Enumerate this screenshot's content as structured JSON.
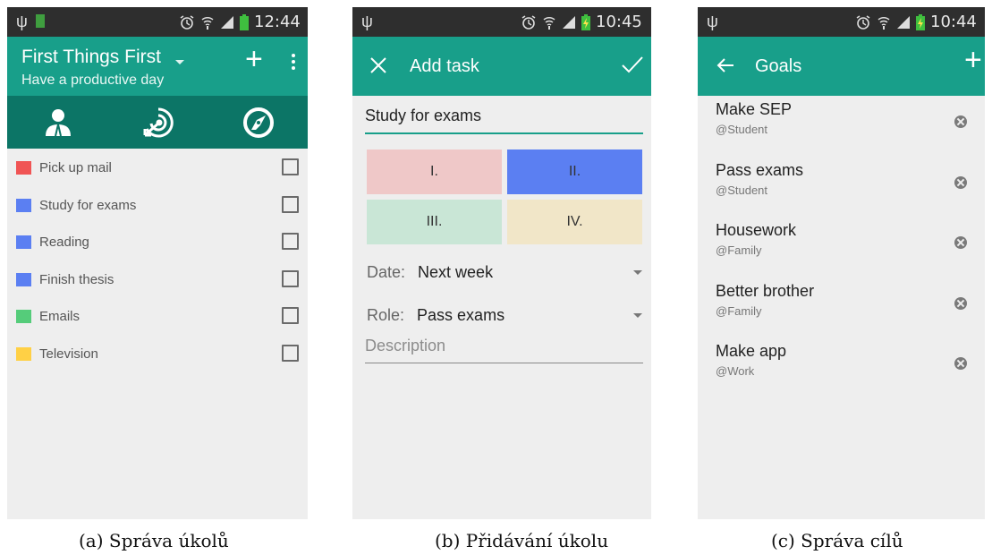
{
  "screen_a": {
    "status_time": "12:44",
    "title": "First Things First",
    "subtitle": "Have a productive day",
    "add_icon": "plus-icon",
    "menu_icon": "more-vert-icon",
    "tabs": [
      {
        "icon": "person-role-icon"
      },
      {
        "icon": "target-arrow-icon"
      },
      {
        "icon": "compass-icon"
      }
    ],
    "tasks": [
      {
        "label": "Pick up mail",
        "color": "#f05454"
      },
      {
        "label": "Study for exams",
        "color": "#5b7ff2"
      },
      {
        "label": "Reading",
        "color": "#5b7ff2"
      },
      {
        "label": "Finish thesis",
        "color": "#5b7ff2"
      },
      {
        "label": "Emails",
        "color": "#55cc7a"
      },
      {
        "label": "Television",
        "color": "#ffd045"
      }
    ],
    "caption": "(a) Správa úkolů"
  },
  "screen_b": {
    "status_time": "10:45",
    "title": "Add task",
    "task_name": "Study for exams",
    "quadrants": [
      {
        "label": "I.",
        "color": "#efc8c8"
      },
      {
        "label": "II.",
        "color": "#5b7ff2"
      },
      {
        "label": "III.",
        "color": "#c9e6d6"
      },
      {
        "label": "IV.",
        "color": "#f1e6c8"
      }
    ],
    "date_label": "Date:",
    "date_value": "Next week",
    "role_label": "Role:",
    "role_value": "Pass exams",
    "description_placeholder": "Description",
    "caption": "(b) Přidávání úkolu"
  },
  "screen_c": {
    "status_time": "10:44",
    "title": "Goals",
    "goals": [
      {
        "name": "Make SEP",
        "role": "@Student"
      },
      {
        "name": "Pass exams",
        "role": "@Student"
      },
      {
        "name": "Housework",
        "role": "@Family"
      },
      {
        "name": "Better brother",
        "role": "@Family"
      },
      {
        "name": "Make app",
        "role": "@Work"
      }
    ],
    "caption": "(c) Správa cílů"
  },
  "colors": {
    "primary": "#189f8a",
    "primary_dark": "#0c7566",
    "status_bar": "#2e2e2e",
    "background": "#eeeeee"
  }
}
